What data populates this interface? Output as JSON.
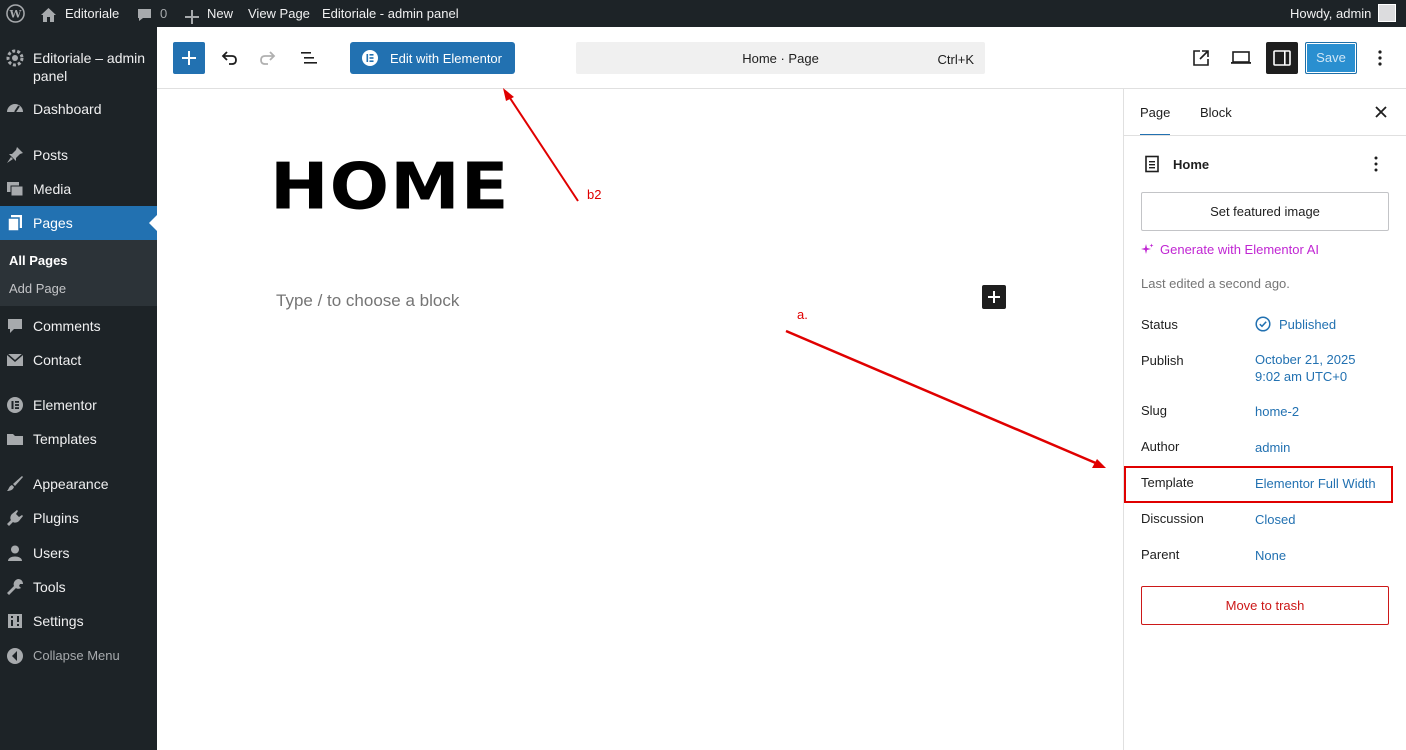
{
  "adminbar": {
    "site_name": "Editoriale",
    "comments_count": "0",
    "new_label": "New",
    "view_page": "View Page",
    "panel_label": "Editoriale - admin panel",
    "howdy": "Howdy, admin"
  },
  "sidebar": {
    "site_title": "Editoriale – admin panel",
    "items": [
      {
        "label": "Dashboard",
        "icon": "dashboard-icon"
      },
      {
        "label": "Posts",
        "icon": "pin-icon"
      },
      {
        "label": "Media",
        "icon": "media-icon"
      },
      {
        "label": "Pages",
        "icon": "pages-icon"
      },
      {
        "label": "Comments",
        "icon": "comment-icon"
      },
      {
        "label": "Contact",
        "icon": "mail-icon"
      },
      {
        "label": "Elementor",
        "icon": "elementor-icon"
      },
      {
        "label": "Templates",
        "icon": "folder-icon"
      },
      {
        "label": "Appearance",
        "icon": "brush-icon"
      },
      {
        "label": "Plugins",
        "icon": "plug-icon"
      },
      {
        "label": "Users",
        "icon": "user-icon"
      },
      {
        "label": "Tools",
        "icon": "wrench-icon"
      },
      {
        "label": "Settings",
        "icon": "settings-icon"
      },
      {
        "label": "Collapse Menu",
        "icon": "collapse-icon"
      }
    ],
    "submenu": [
      "All Pages",
      "Add Page"
    ]
  },
  "header": {
    "elementor_label": "Edit with Elementor",
    "command_title": "Home · Page",
    "command_shortcut": "Ctrl+K",
    "save_label": "Save"
  },
  "canvas": {
    "heading": "HOME",
    "placeholder": "Type / to choose a block"
  },
  "settings": {
    "tabs": [
      "Page",
      "Block"
    ],
    "page_title": "Home",
    "featured_image_label": "Set featured image",
    "ai_label": "Generate with Elementor AI",
    "last_edited": "Last edited a second ago.",
    "rows": [
      {
        "label": "Status",
        "value": "Published"
      },
      {
        "label": "Publish",
        "value": "October 21, 2025",
        "value2": "9:02 am UTC+0"
      },
      {
        "label": "Slug",
        "value": "home-2"
      },
      {
        "label": "Author",
        "value": "admin"
      },
      {
        "label": "Template",
        "value": "Elementor Full Width"
      },
      {
        "label": "Discussion",
        "value": "Closed"
      },
      {
        "label": "Parent",
        "value": "None"
      }
    ],
    "trash_label": "Move to trash"
  },
  "annotations": {
    "label_b2": "b2",
    "label_a": "a."
  },
  "colors": {
    "wp_blue": "#2271b1",
    "admin_dark": "#1d2327",
    "annotation_red": "#e00000",
    "ai_purple": "#c026d3",
    "trash_red": "#cc1818"
  }
}
